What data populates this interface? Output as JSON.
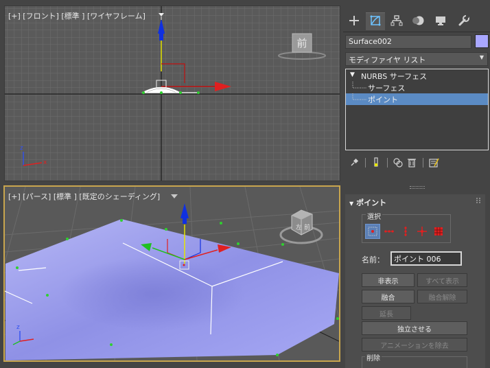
{
  "viewports": {
    "top": {
      "label": "[+] [フロント] [標準 ] [ワイヤフレーム]",
      "viewcube_label": "前"
    },
    "perspective": {
      "label": "[+] [パース] [標準 ] [既定のシェーディング]"
    }
  },
  "command_panel": {
    "tabs": [
      {
        "name": "create",
        "icon": "plus-icon"
      },
      {
        "name": "modify",
        "icon": "modify-icon",
        "active": true
      },
      {
        "name": "hierarchy",
        "icon": "hierarchy-icon"
      },
      {
        "name": "motion",
        "icon": "motion-icon"
      },
      {
        "name": "display",
        "icon": "display-icon"
      },
      {
        "name": "utilities",
        "icon": "wrench-icon"
      }
    ],
    "object_name": "Surface002",
    "object_color": "#a9a7ff",
    "modifier_list": "モディファイヤ リスト",
    "stack": {
      "root": "NURBS サーフェス",
      "children": [
        "サーフェス",
        "ポイント"
      ],
      "selected": "ポイント"
    },
    "rollout": {
      "title": "ポイント",
      "selection_group": "選択",
      "name_label": "名前：",
      "name_value": "ポイント 006",
      "buttons": {
        "hide": "非表示",
        "unhide_all": "すべて表示",
        "fuse": "融合",
        "unfuse": "融合解除",
        "extend": "延長",
        "make_independent": "独立させる",
        "remove_animation": "アニメーションを除去"
      },
      "delete_group": "削除"
    }
  },
  "colors": {
    "accent_selection": "#5b8bc4",
    "active_viewport_border": "#c9a64e",
    "surface_fill": "#a4a6f2",
    "axis_x": "#e02020",
    "axis_y": "#20c020",
    "axis_z": "#1030e0"
  }
}
